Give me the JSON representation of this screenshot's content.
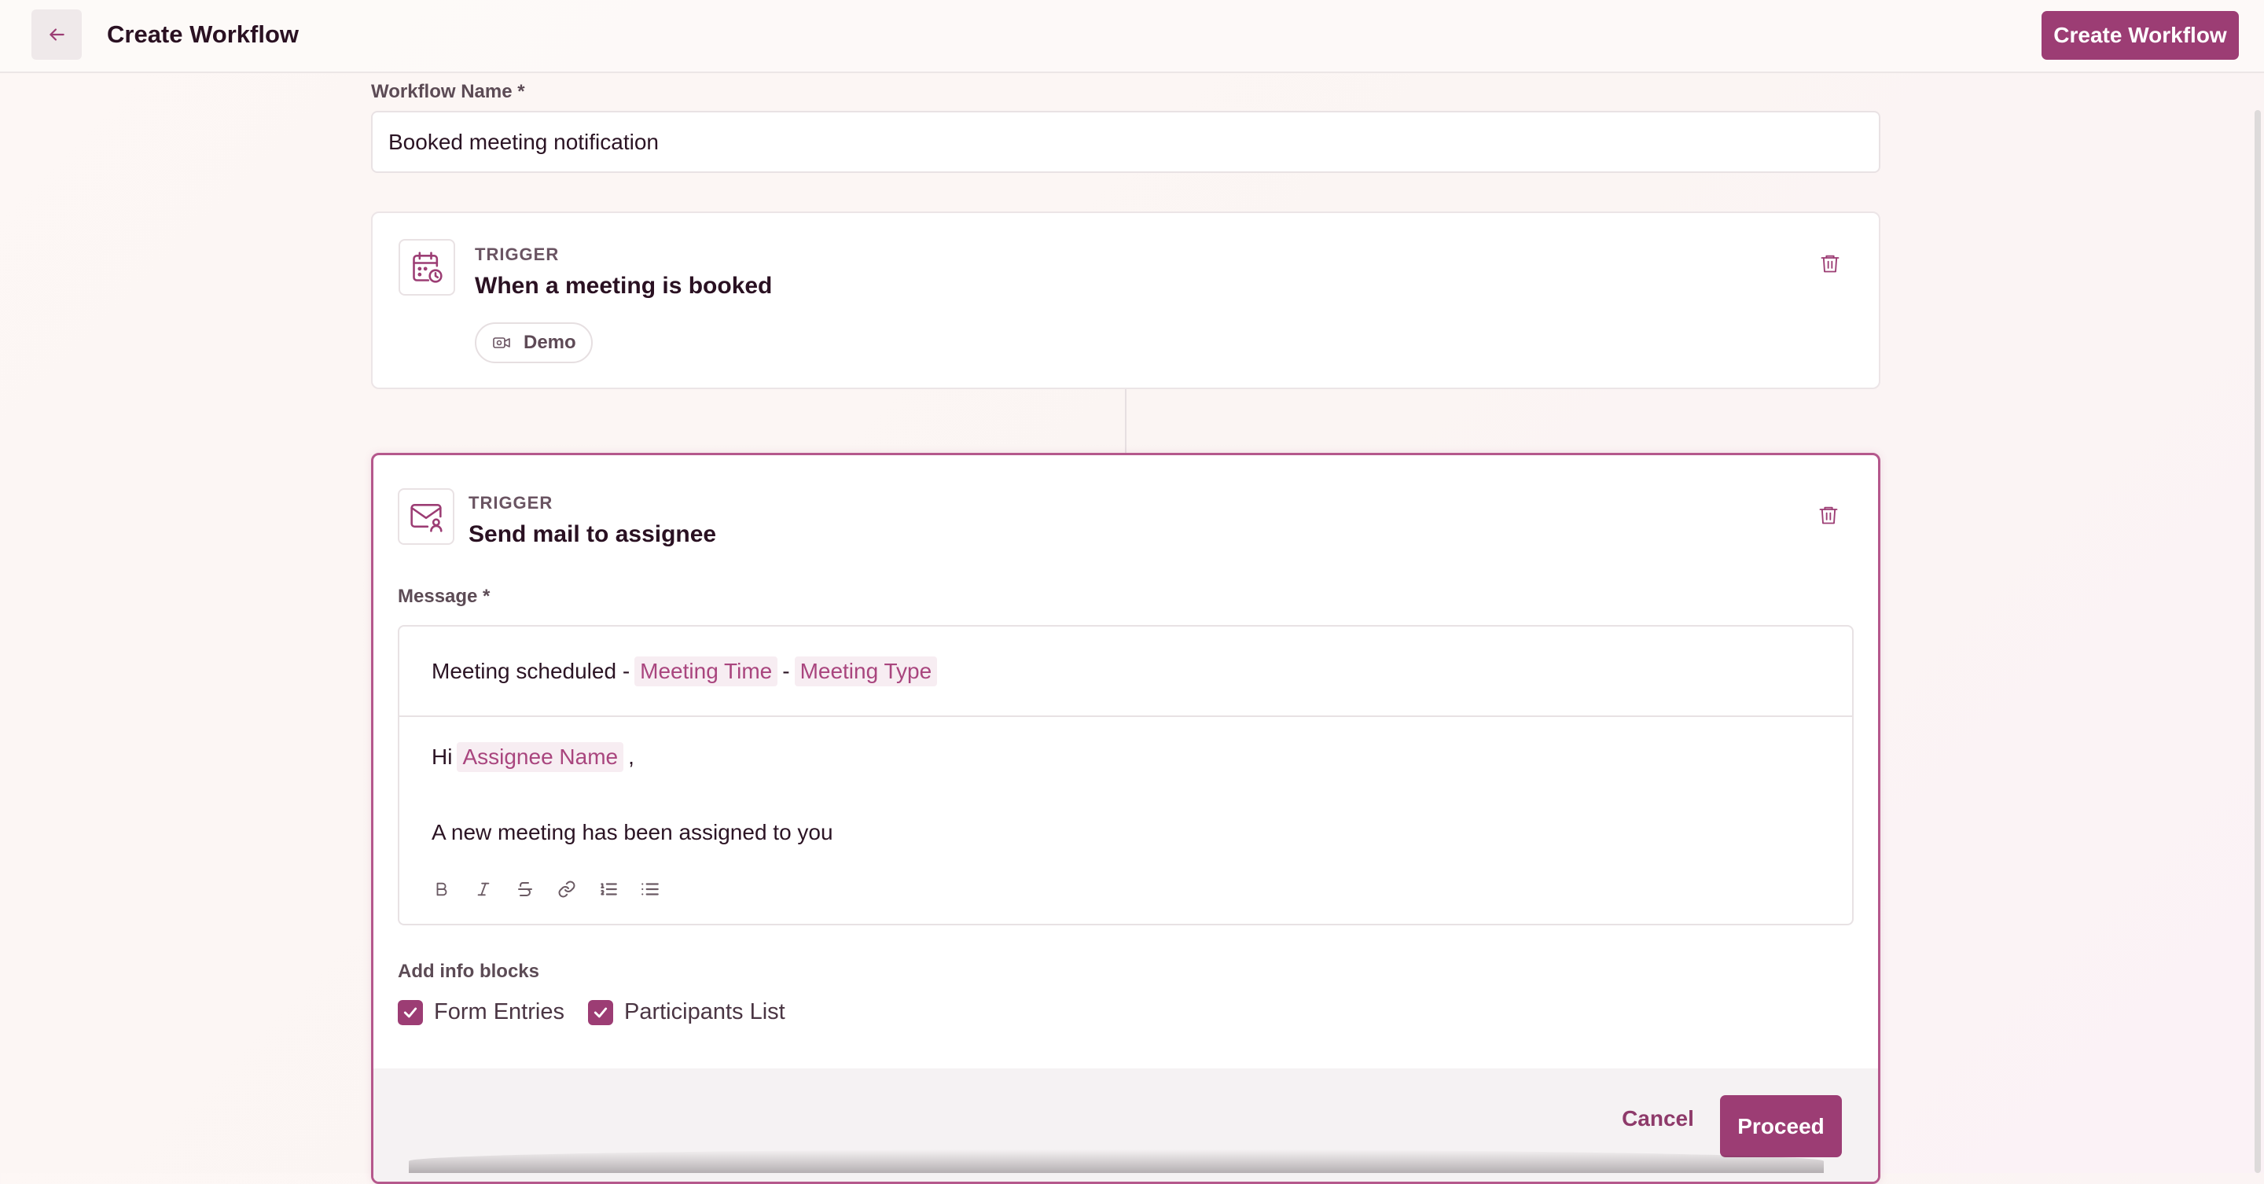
{
  "header": {
    "title": "Create Workflow",
    "create_button_label": "Create Workflow"
  },
  "workflow_name": {
    "label": "Workflow Name *",
    "value": "Booked meeting notification"
  },
  "trigger_card": {
    "label": "TRIGGER",
    "title": "When a meeting is booked",
    "chip_label": "Demo"
  },
  "action_card": {
    "label": "TRIGGER",
    "title": "Send mail to assignee",
    "message_label": "Message *",
    "subject": {
      "prefix": "Meeting scheduled -",
      "tag1": "Meeting Time",
      "separator": "-",
      "tag2": "Meeting Type"
    },
    "body": {
      "greeting": "Hi",
      "name_tag": "Assignee Name",
      "comma": ",",
      "line": "A new meeting has been assigned to you"
    },
    "toolbar": [
      "bold-icon",
      "italic-icon",
      "strikethrough-icon",
      "link-icon",
      "ordered-list-icon",
      "bullet-list-icon"
    ],
    "info_blocks_label": "Add info blocks",
    "info_blocks": [
      {
        "label": "Form Entries",
        "checked": true
      },
      {
        "label": "Participants List",
        "checked": true
      }
    ],
    "cancel_label": "Cancel",
    "proceed_label": "Proceed"
  },
  "colors": {
    "accent": "#9c3d74",
    "tag_text": "#a9457e",
    "tag_bg": "#f7edf2"
  }
}
